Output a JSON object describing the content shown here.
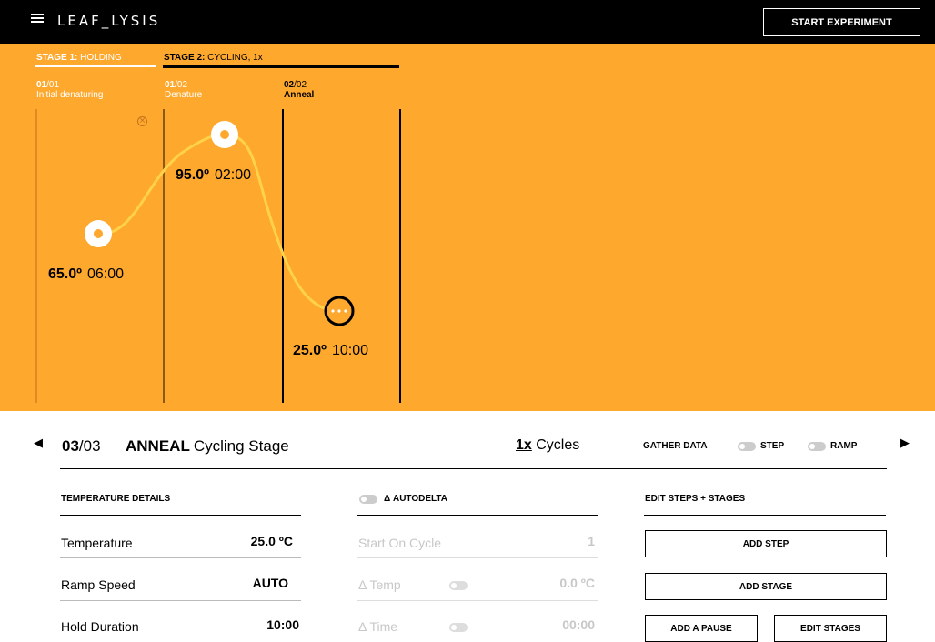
{
  "app": {
    "logo": "LEAF_LYSIS",
    "start_button": "START EXPERIMENT"
  },
  "stages": [
    {
      "bold": "STAGE 1:",
      "label": " HOLDING"
    },
    {
      "bold": "STAGE 2:",
      "label": " CYCLING, 1x"
    }
  ],
  "steps": [
    {
      "num": "01",
      "total": "/01",
      "name": "Initial denaturing",
      "temp": "65.0º",
      "time": "06:00"
    },
    {
      "num": "01",
      "total": "/02",
      "name": "Denature",
      "temp": "95.0º",
      "time": "02:00"
    },
    {
      "num": "02",
      "total": "/02",
      "name": "Anneal",
      "temp": "25.0º",
      "time": "10:00"
    }
  ],
  "selected": {
    "index": "03",
    "count": "/03",
    "name": "ANNEAL",
    "stage_type": "Cycling Stage",
    "cycles_num": "1x",
    "cycles_label": "Cycles"
  },
  "gather": {
    "label": "GATHER DATA",
    "step": "STEP",
    "ramp": "RAMP"
  },
  "temperature_details": {
    "title": "TEMPERATURE DETAILS",
    "rows": [
      {
        "label": "Temperature",
        "value": "25.0 ºC"
      },
      {
        "label": "Ramp Speed",
        "value": "AUTO"
      },
      {
        "label": "Hold Duration",
        "value": "10:00"
      }
    ]
  },
  "autodelta": {
    "title": "Δ AUTODELTA",
    "rows": [
      {
        "label": "Start On Cycle",
        "value": "1"
      },
      {
        "label": "Δ Temp",
        "value": "0.0 ºC"
      },
      {
        "label": "Δ Time",
        "value": "00:00"
      }
    ]
  },
  "edit": {
    "title": "EDIT STEPS + STAGES",
    "add_step": "ADD STEP",
    "add_stage": "ADD STAGE",
    "add_pause": "ADD A PAUSE",
    "edit_stages": "EDIT STAGES"
  },
  "colors": {
    "accent": "#FEA82E",
    "topbar": "#000000",
    "curve": "#FFD24A"
  }
}
